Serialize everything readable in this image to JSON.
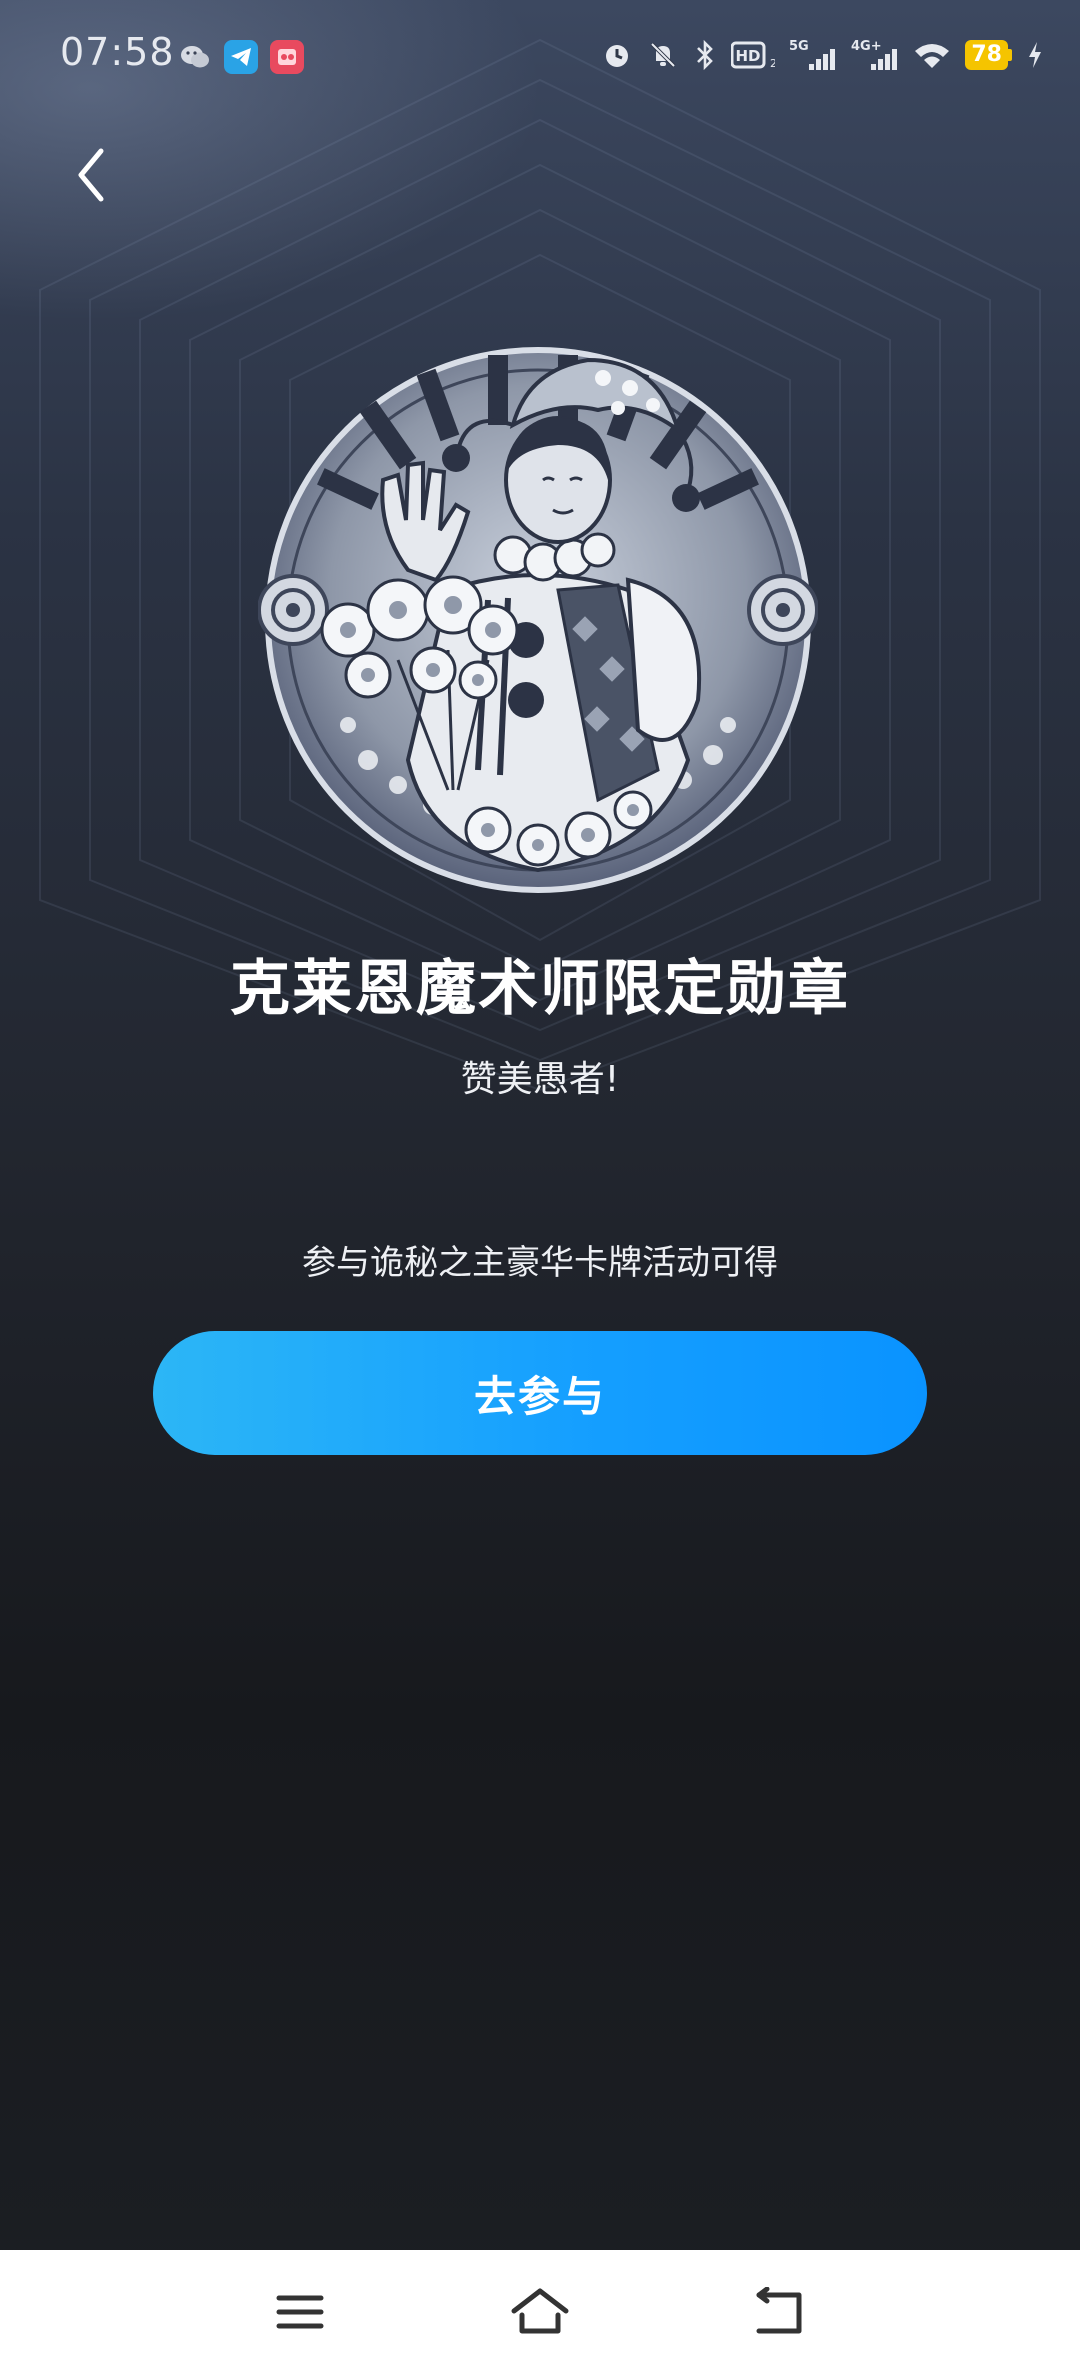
{
  "status_bar": {
    "time": "07:58",
    "battery_level": "78",
    "app_icons": [
      "wechat-icon",
      "telegram-icon",
      "game-app-icon"
    ],
    "system_icons": [
      "alarm-icon",
      "mute-icon",
      "bluetooth-icon",
      "hd-voice-icon",
      "5g-signal-icon",
      "4g-signal-icon",
      "wifi-icon",
      "charging-icon"
    ]
  },
  "header": {
    "back_icon": "chevron-left-icon"
  },
  "badge": {
    "title": "克莱恩魔术师限定勋章",
    "subtitle": "赞美愚者!",
    "description": "参与诡秘之主豪华卡牌活动可得",
    "action_label": "去参与"
  },
  "nav_bar": {
    "items": [
      "menu-icon",
      "home-icon",
      "back-icon"
    ]
  },
  "colors": {
    "button_start": "#2cb6f6",
    "button_end": "#0a93ff",
    "battery": "#f5c400"
  }
}
